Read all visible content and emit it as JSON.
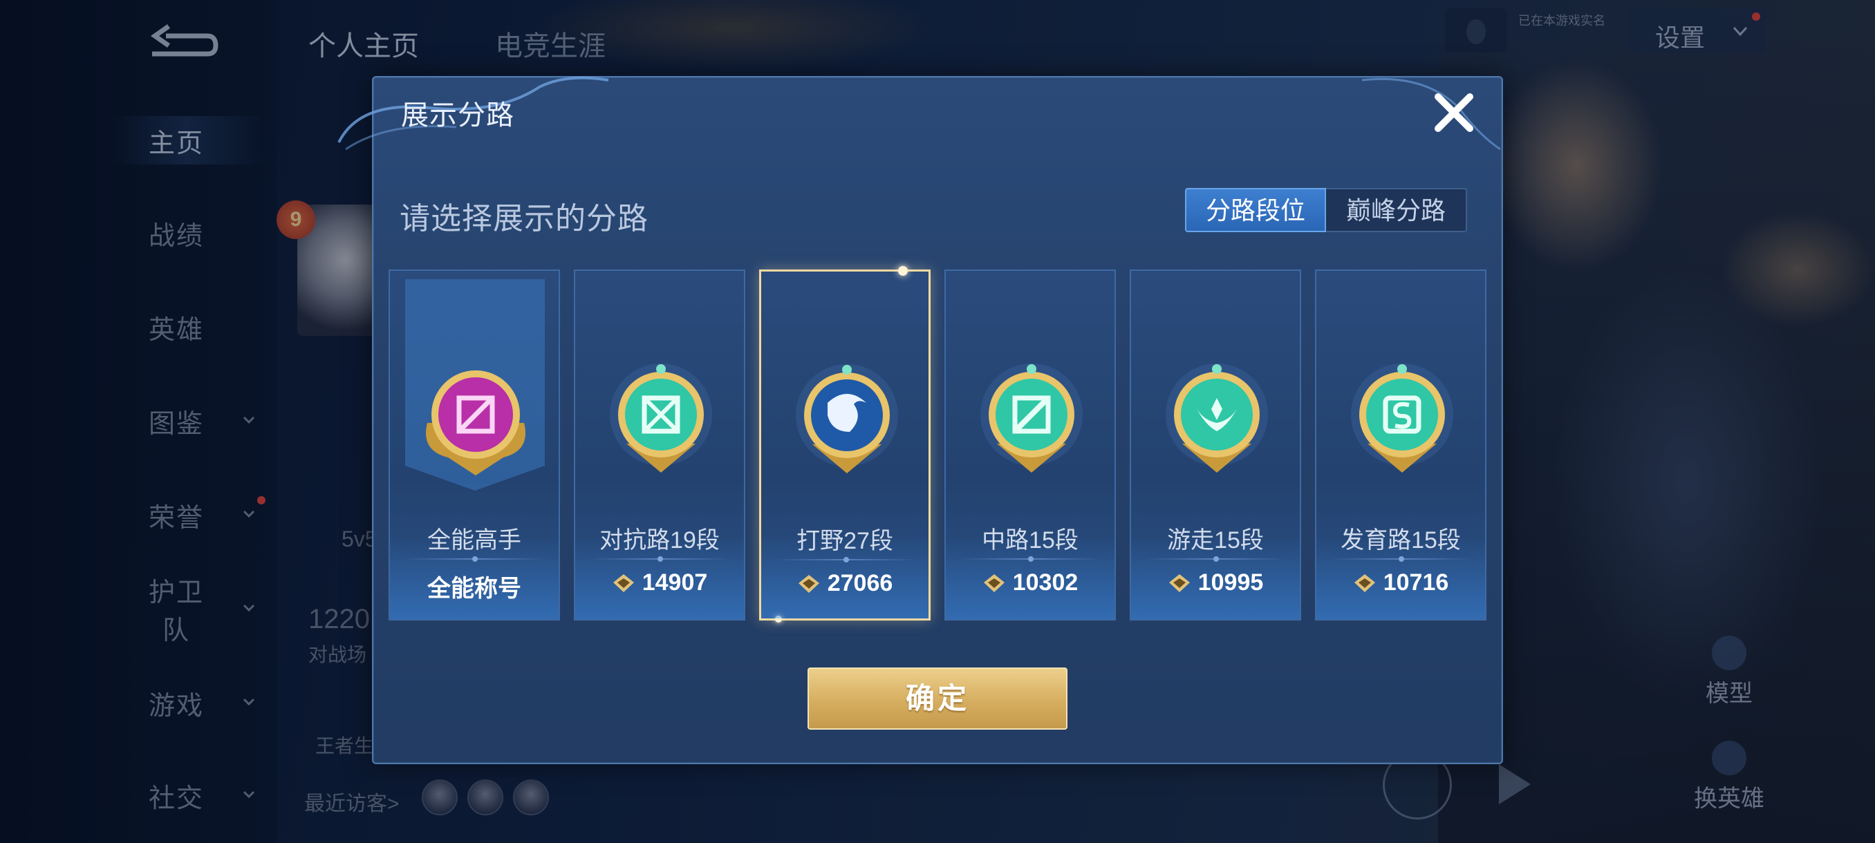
{
  "header": {
    "tabs": [
      {
        "label": "个人主页"
      },
      {
        "label": "电竞生涯"
      }
    ],
    "tag_text": "已在本游戏实名",
    "settings_label": "设置"
  },
  "sidebar": {
    "items": [
      {
        "label": "主页"
      },
      {
        "label": "战绩"
      },
      {
        "label": "英雄"
      },
      {
        "label": "图鉴"
      },
      {
        "label": "荣誉"
      },
      {
        "label": "护卫队"
      },
      {
        "label": "游戏"
      },
      {
        "label": "社交"
      }
    ]
  },
  "profile": {
    "level": "9",
    "mode_text": "5v5",
    "count_text": "1220",
    "count_label": "对战场",
    "rank_label": "王者生",
    "recent_visitors": "最近访客>"
  },
  "right_panel": {
    "model_label": "模型",
    "change_hero_label": "换英雄"
  },
  "modal": {
    "title": "展示分路",
    "subtitle": "请选择展示的分路",
    "segments": {
      "left": "分路段位",
      "right": "巅峰分路",
      "active": "left"
    },
    "cards": [
      {
        "label": "全能高手",
        "value": "全能称号",
        "medal": "all-round-medal",
        "color": "#c23bb6"
      },
      {
        "label": "对抗路19段",
        "value": "14907",
        "medal": "clash-lane-medal",
        "color": "#2fc7a6"
      },
      {
        "label": "打野27段",
        "value": "27066",
        "medal": "jungle-medal",
        "color": "#2f7fd0",
        "selected": true
      },
      {
        "label": "中路15段",
        "value": "10302",
        "medal": "mid-lane-medal",
        "color": "#2fc7a6"
      },
      {
        "label": "游走15段",
        "value": "10995",
        "medal": "roam-medal",
        "color": "#2fc7a6"
      },
      {
        "label": "发育路15段",
        "value": "10716",
        "medal": "farm-lane-medal",
        "color": "#2fc7a6"
      }
    ],
    "confirm_label": "确定"
  },
  "colors": {
    "gold": "#d6ae60",
    "selected_border": "#f1d9a0",
    "segment_active": "#3e7fd0"
  }
}
